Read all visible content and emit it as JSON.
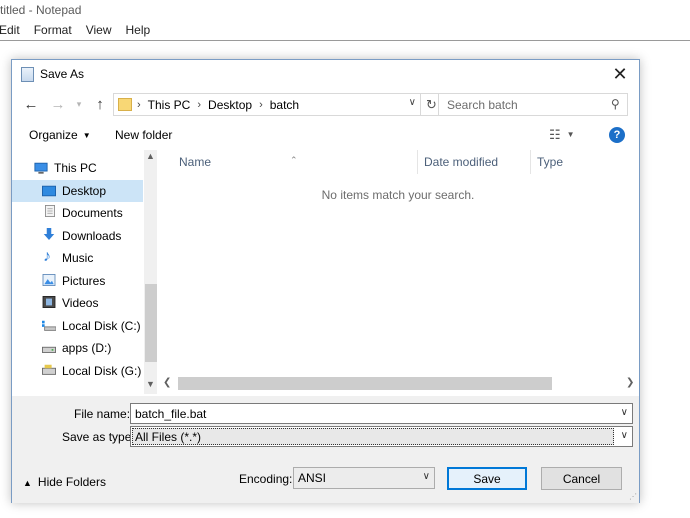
{
  "notepad": {
    "title": "titled - Notepad",
    "menu": [
      "Edit",
      "Format",
      "View",
      "Help"
    ]
  },
  "dialog": {
    "title": "Save As",
    "close_symbol": "✕",
    "address": {
      "crumbs": [
        "This PC",
        "Desktop",
        "batch"
      ]
    },
    "search": {
      "placeholder": "Search batch"
    },
    "toolbar": {
      "organize": "Organize",
      "new_folder": "New folder",
      "help": "?"
    },
    "nav_items": [
      {
        "label": "This PC",
        "icon": "pc-icon"
      },
      {
        "label": "Desktop",
        "icon": "desktop-icon",
        "selected": true
      },
      {
        "label": "Documents",
        "icon": "documents-icon"
      },
      {
        "label": "Downloads",
        "icon": "downloads-icon"
      },
      {
        "label": "Music",
        "icon": "music-icon"
      },
      {
        "label": "Pictures",
        "icon": "pictures-icon"
      },
      {
        "label": "Videos",
        "icon": "videos-icon"
      },
      {
        "label": "Local Disk (C:)",
        "icon": "disk-icon"
      },
      {
        "label": "apps (D:)",
        "icon": "drive-icon"
      },
      {
        "label": "Local Disk (G:)",
        "icon": "drive-icon"
      }
    ],
    "columns": {
      "name": "Name",
      "date_modified": "Date modified",
      "type": "Type"
    },
    "empty_message": "No items match your search.",
    "form": {
      "file_name_label": "File name:",
      "file_name_value": "batch_file.bat",
      "save_as_type_label": "Save as type:",
      "save_as_type_value": "All Files  (*.*)",
      "hide_folders": "Hide Folders",
      "encoding_label": "Encoding:",
      "encoding_value": "ANSI",
      "save_button": "Save",
      "cancel_button": "Cancel"
    },
    "colors": {
      "accent": "#0078d7",
      "selection": "#cce4f7",
      "help": "#1c6fc8"
    }
  }
}
